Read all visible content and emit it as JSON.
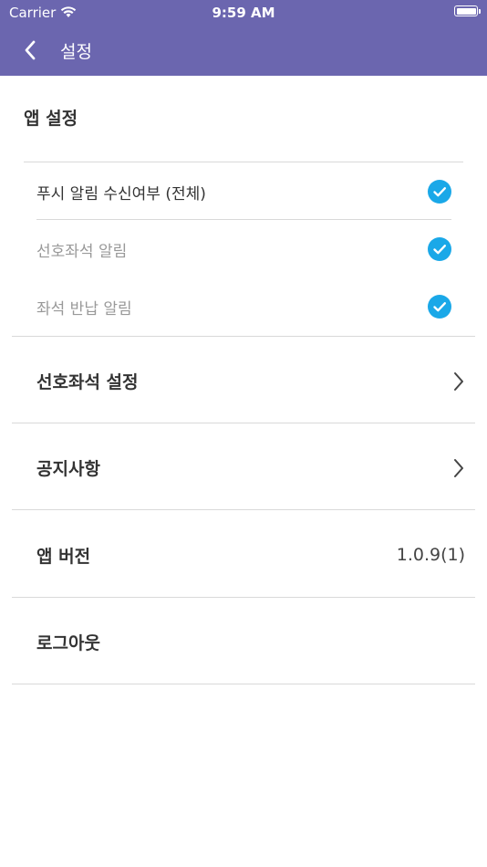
{
  "status_bar": {
    "carrier": "Carrier",
    "time": "9:59 AM"
  },
  "nav": {
    "title": "설정"
  },
  "app_settings": {
    "title": "앱 설정",
    "items": [
      {
        "label": "푸시 알림 수신여부 (전체)",
        "checked": true,
        "enabled": true
      },
      {
        "label": "선호좌석 알림",
        "checked": true,
        "enabled": false
      },
      {
        "label": "좌석 반납 알림",
        "checked": true,
        "enabled": false
      }
    ]
  },
  "menu": {
    "favorite_seat": "선호좌석 설정",
    "notice": "공지사항",
    "version_label": "앱 버전",
    "version_value": "1.0.9(1)",
    "logout": "로그아웃"
  },
  "colors": {
    "header": "#6b66af",
    "check": "#1aa8e8",
    "disabled_text": "#999999",
    "text": "#333333"
  }
}
